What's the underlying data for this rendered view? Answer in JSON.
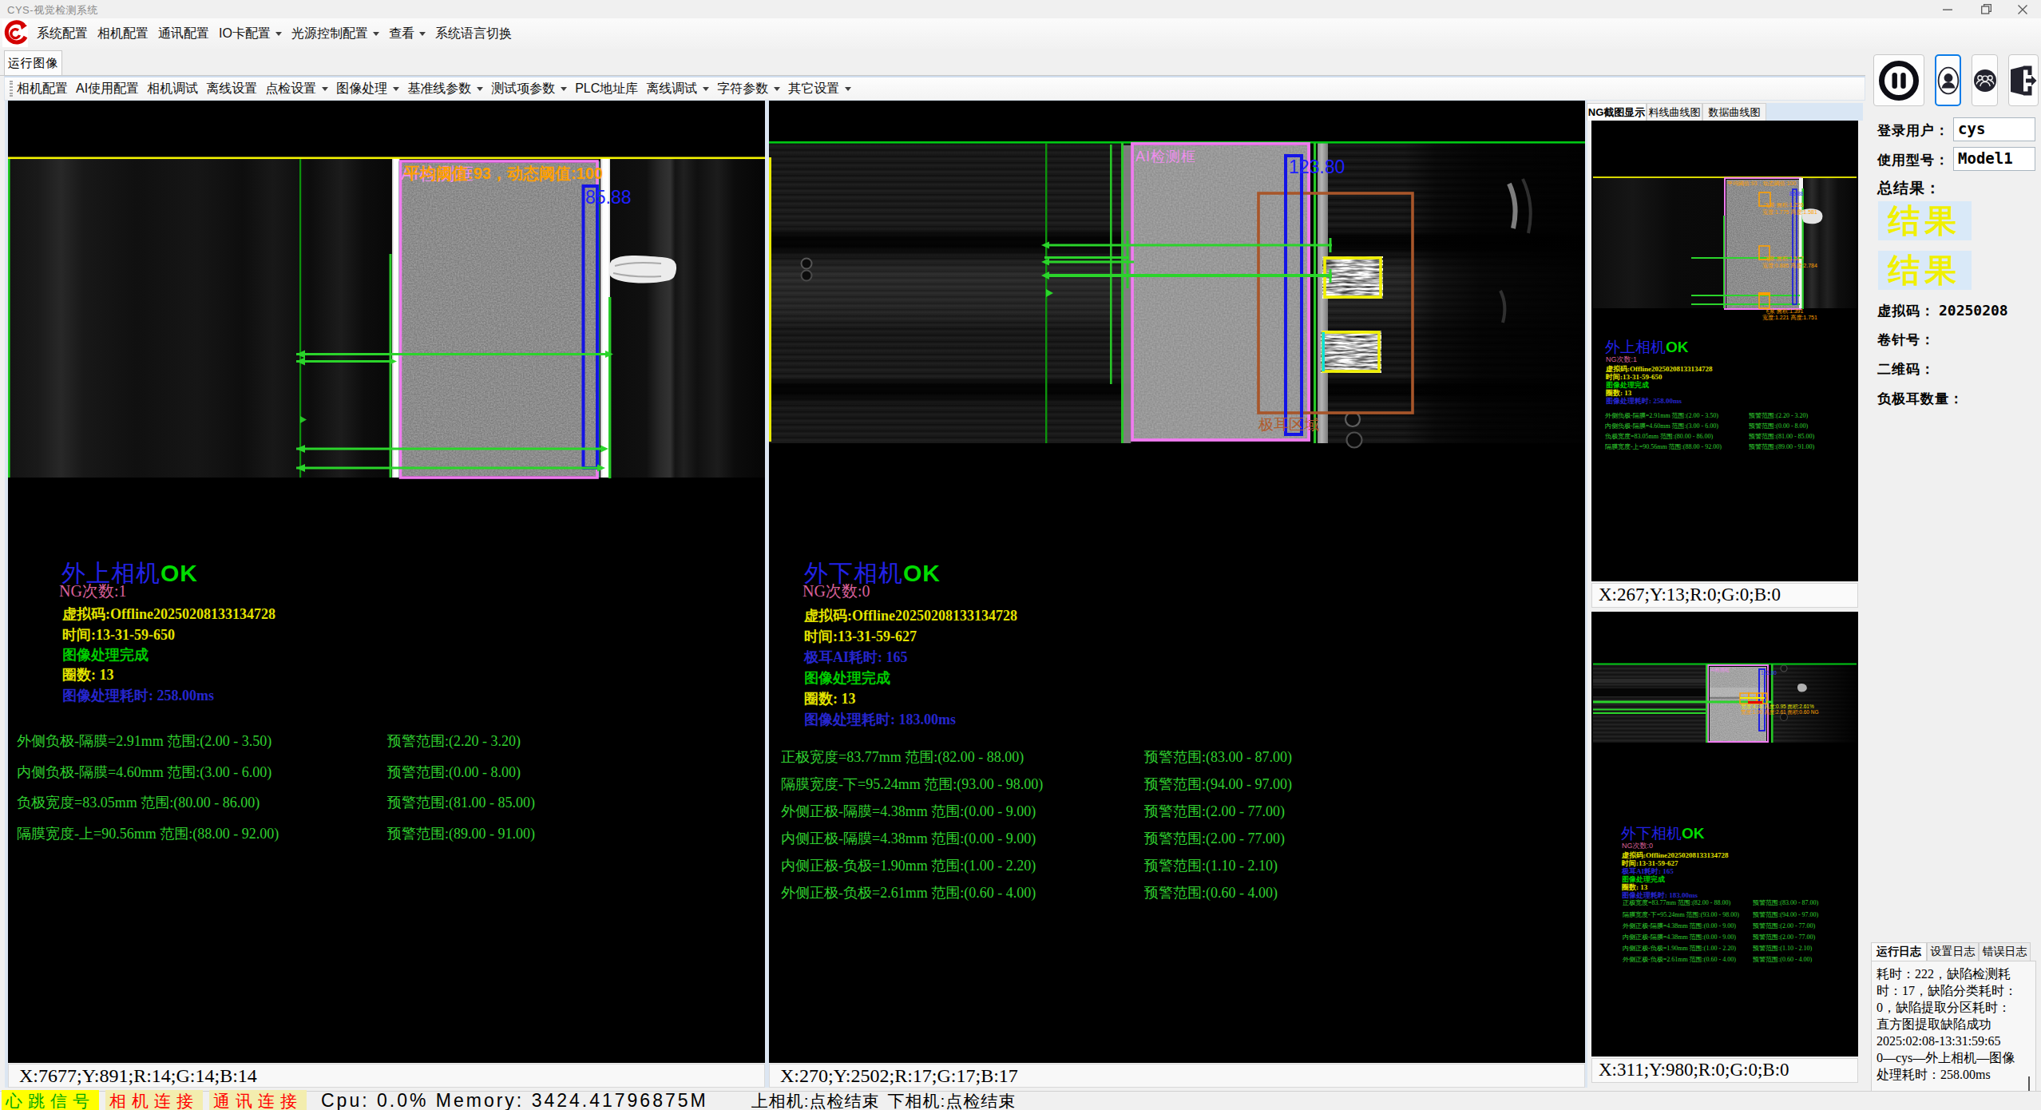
{
  "window": {
    "title": "CYS-视觉检测系统"
  },
  "menu": {
    "items": [
      {
        "label": "系统配置",
        "arrow": false
      },
      {
        "label": "相机配置",
        "arrow": false
      },
      {
        "label": "通讯配置",
        "arrow": false
      },
      {
        "label": "IO卡配置",
        "arrow": true
      },
      {
        "label": "光源控制配置",
        "arrow": true
      },
      {
        "label": "查看",
        "arrow": true
      },
      {
        "label": "系统语言切换",
        "arrow": false
      }
    ]
  },
  "page_tab": "运行图像",
  "toolbar": {
    "items": [
      {
        "label": "相机配置",
        "arrow": false
      },
      {
        "label": "AI使用配置",
        "arrow": false
      },
      {
        "label": "相机调试",
        "arrow": false
      },
      {
        "label": "离线设置",
        "arrow": false
      },
      {
        "label": "点检设置",
        "arrow": true
      },
      {
        "label": "图像处理",
        "arrow": true
      },
      {
        "label": "基准线参数",
        "arrow": true
      },
      {
        "label": "测试项参数",
        "arrow": true
      },
      {
        "label": "PLC地址库",
        "arrow": false
      },
      {
        "label": "离线调试",
        "arrow": true
      },
      {
        "label": "字符参数",
        "arrow": true
      },
      {
        "label": "其它设置",
        "arrow": true
      }
    ]
  },
  "left_camera": {
    "threshold_text": "平均阈值:93，动态阈值:100",
    "ai_box_label": "AI检测框",
    "blue_value": "85.88",
    "title": "外上相机",
    "ok": "OK",
    "ng_count": "NG次数:1",
    "info": {
      "vcode": "虚拟码:Offline20250208133134728",
      "time": "时间:13-31-59-650",
      "done": "图像处理完成",
      "loops": "圈数: 13",
      "elapsed": "图像处理耗时: 258.00ms"
    },
    "measurements": [
      {
        "l": "外侧负极-隔膜=2.91mm 范围:(2.00 - 3.50)",
        "r": "预警范围:(2.20 - 3.20)"
      },
      {
        "l": "内侧负极-隔膜=4.60mm 范围:(3.00 - 6.00)",
        "r": "预警范围:(0.00 - 8.00)"
      },
      {
        "l": "负极宽度=83.05mm 范围:(80.00 - 86.00)",
        "r": "预警范围:(81.00 - 85.00)"
      },
      {
        "l": "隔膜宽度-上=90.56mm 范围:(88.00 - 92.00)",
        "r": "预警范围:(89.00 - 91.00)"
      }
    ],
    "status_line": "X:7677;Y:891;R:14;G:14;B:14"
  },
  "right_camera": {
    "ai_box_label": "AI检测框",
    "tab_region_label": "极耳区域",
    "blue_value": "123.80",
    "title": "外下相机",
    "ok": "OK",
    "ng_count": "NG次数:0",
    "info": {
      "vcode": "虚拟码:Offline20250208133134728",
      "time": "时间:13-31-59-627",
      "ai_time": "极耳AI耗时: 165",
      "done": "图像处理完成",
      "loops": "圈数: 13",
      "elapsed": "图像处理耗时: 183.00ms"
    },
    "measurements": [
      {
        "l": "正极宽度=83.77mm 范围:(82.00 - 88.00)",
        "r": "预警范围:(83.00 - 87.00)"
      },
      {
        "l": "隔膜宽度-下=95.24mm 范围:(93.00 - 98.00)",
        "r": "预警范围:(94.00 - 97.00)"
      },
      {
        "l": "外侧正极-隔膜=4.38mm 范围:(0.00 - 9.00)",
        "r": "预警范围:(2.00 - 77.00)"
      },
      {
        "l": "内侧正极-隔膜=4.38mm 范围:(0.00 - 9.00)",
        "r": "预警范围:(2.00 - 77.00)"
      },
      {
        "l": "内侧正极-负极=1.90mm 范围:(1.00 - 2.20)",
        "r": "预警范围:(1.10 - 2.10)"
      },
      {
        "l": "外侧正极-负极=2.61mm 范围:(0.60 - 4.00)",
        "r": "预警范围:(0.60 - 4.00)"
      }
    ],
    "status_line": "X:270;Y:2502;R:17;G:17;B:17"
  },
  "side_panel": {
    "tabs": [
      "NG截图显示",
      "料线曲线图",
      "数据曲线图"
    ],
    "preview1": {
      "threshold_text": "平均阈值:93，动态阈值:100",
      "blue_value": "85.88",
      "title": "外上相机",
      "ok": "OK",
      "ng_count": "NG次数:1",
      "info": {
        "vcode": "虚拟码:Offline20250208133134728",
        "time": "时间:13-31-59-650",
        "done": "图像处理完成",
        "loops": "圈数: 13",
        "elapsed": "图像处理耗时: 258.00ms"
      },
      "defects": [
        {
          "a": "飞浆 面积:1.226",
          "b": "宽度:1.775 高度:1.581"
        },
        {
          "a": "飞浆 面积:1.517",
          "b": "宽度:0.885 高度:2.784"
        },
        {
          "a": "飞浆 面积:1.391",
          "b": "宽度:1.221 高度:1.751"
        }
      ],
      "measurements": [
        {
          "l": "外侧负极-隔膜=2.91mm 范围:(2.00 - 3.50)",
          "r": "预警范围:(2.20 - 3.20)"
        },
        {
          "l": "内侧负极-隔膜=4.60mm 范围:(3.00 - 6.00)",
          "r": "预警范围:(0.00 - 8.00)"
        },
        {
          "l": "负极宽度=83.05mm 范围:(80.00 - 86.00)",
          "r": "预警范围:(81.00 - 85.00)"
        },
        {
          "l": "隔膜宽度-上=90.56mm 范围:(88.00 - 92.00)",
          "r": "预警范围:(89.00 - 91.00)"
        }
      ],
      "status_line": "X:267;Y:13;R:0;G:0;B:0"
    },
    "preview2": {
      "ai_box_label": "AI检测框",
      "blue_value": "123.80",
      "title": "外下相机",
      "ok": "OK",
      "ng_count": "NG次数:0",
      "info": {
        "vcode": "虚拟码:Offline20250208133134728",
        "time": "时间:13-31-59-627",
        "ai_time": "极耳AI耗时: 165",
        "done": "图像处理完成",
        "loops": "圈数: 13",
        "elapsed": "图像处理耗时: 183.00ms"
      },
      "tab_text_yellow": "宽度:4.38 高度:0.95 面积:2.61%",
      "tab_text_orange": "宽度:1.90 高度:2.61 面积:0.60 NG",
      "measurements": [
        {
          "l": "正极宽度=83.77mm 范围:(82.00 - 88.00)",
          "r": "预警范围:(83.00 - 87.00)"
        },
        {
          "l": "隔膜宽度-下=95.24mm 范围:(93.00 - 98.00)",
          "r": "预警范围:(94.00 - 97.00)"
        },
        {
          "l": "外侧正极-隔膜=4.38mm 范围:(0.00 - 9.00)",
          "r": "预警范围:(2.00 - 77.00)"
        },
        {
          "l": "内侧正极-隔膜=4.38mm 范围:(0.00 - 9.00)",
          "r": "预警范围:(2.00 - 77.00)"
        },
        {
          "l": "内侧正极-负极=1.90mm 范围:(1.00 - 2.20)",
          "r": "预警范围:(1.10 - 2.10)"
        },
        {
          "l": "外侧正极-负极=2.61mm 范围:(0.60 - 4.00)",
          "r": "预警范围:(0.60 - 4.00)"
        }
      ],
      "status_line": "X:311;Y:980;R:0;G:0;B:0"
    }
  },
  "right_column": {
    "login_label": "登录用户：",
    "login_value": "cys",
    "model_label": "使用型号：",
    "model_value": "Model1",
    "total_label": "总结果：",
    "result_text": "结果",
    "vcode_label": "虚拟码：",
    "vcode_value": "20250208",
    "reel_label": "卷针号：",
    "qr_label": "二维码：",
    "neg_tab_label": "负极耳数量："
  },
  "log_panel": {
    "tabs": [
      "运行日志",
      "设置日志",
      "错误日志"
    ],
    "lines": [
      "耗时：222，缺陷检测耗",
      "时：17，缺陷分类耗时：",
      "0，缺陷提取分区耗时：",
      "直方图提取缺陷成功",
      "2025:02:08-13:31:59:65",
      "0—cys—外上相机—图像",
      "处理耗时：258.00ms"
    ]
  },
  "status_bar": {
    "heartbeat": "心跳信号",
    "camera": "相机连接",
    "comm": "通讯连接",
    "cpu": "Cpu:  0.0% Memory:  3424.41796875M",
    "upper": "上相机:点检结束",
    "lower": "下相机:点检结束"
  },
  "colors": {
    "ok_green": "#00dc00",
    "title_blue": "#2222e6",
    "ng_pink": "#d8609a",
    "info_yellow": "#e3e300",
    "measure_green": "#30d030",
    "overlay_pink": "#f07cf0",
    "overlay_orange": "#ffa000",
    "overlay_blue": "#1414e6",
    "overlay_brown": "#a8562a",
    "overlay_yellow": "#f0f000",
    "heartbeat_bg": "#ffff00",
    "heartbeat_fg": "#00a800",
    "link_red": "#ff0000",
    "result_bg": "#d9e9f8",
    "result_fg": "#f0f000"
  }
}
